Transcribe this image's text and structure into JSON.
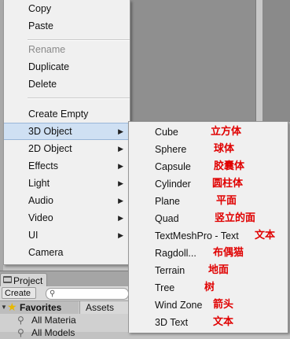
{
  "main_menu": {
    "items": [
      {
        "label": "Copy",
        "disabled": false,
        "submenu": false
      },
      {
        "label": "Paste",
        "disabled": false,
        "submenu": false
      },
      {
        "label": "Rename",
        "disabled": true,
        "submenu": false
      },
      {
        "label": "Duplicate",
        "disabled": false,
        "submenu": false
      },
      {
        "label": "Delete",
        "disabled": false,
        "submenu": false
      },
      {
        "label": "Create Empty",
        "disabled": false,
        "submenu": false
      },
      {
        "label": "3D Object",
        "disabled": false,
        "submenu": true,
        "selected": true
      },
      {
        "label": "2D Object",
        "disabled": false,
        "submenu": true
      },
      {
        "label": "Effects",
        "disabled": false,
        "submenu": true
      },
      {
        "label": "Light",
        "disabled": false,
        "submenu": true
      },
      {
        "label": "Audio",
        "disabled": false,
        "submenu": true
      },
      {
        "label": "Video",
        "disabled": false,
        "submenu": true
      },
      {
        "label": "UI",
        "disabled": false,
        "submenu": true
      },
      {
        "label": "Camera",
        "disabled": false,
        "submenu": false
      }
    ],
    "arrow_glyph": "▶"
  },
  "submenu_3d": {
    "items": [
      {
        "label": "Cube",
        "annotation": "立方体"
      },
      {
        "label": "Sphere",
        "annotation": "球体"
      },
      {
        "label": "Capsule",
        "annotation": "胶囊体"
      },
      {
        "label": "Cylinder",
        "annotation": "圆柱体"
      },
      {
        "label": "Plane",
        "annotation": "平面"
      },
      {
        "label": "Quad",
        "annotation": "竖立的面"
      },
      {
        "label": "TextMeshPro - Text",
        "annotation": "文本"
      },
      {
        "label": "Ragdoll...",
        "annotation": "布偶猫"
      },
      {
        "label": "Terrain",
        "annotation": "地面"
      },
      {
        "label": "Tree",
        "annotation": "树"
      },
      {
        "label": "Wind Zone",
        "annotation": "箭头"
      },
      {
        "label": "3D Text",
        "annotation": "文本"
      }
    ],
    "annotation_color": "#e00000"
  },
  "project_panel": {
    "tab_label": "Project",
    "create_label": "Create ▾",
    "favorites_label": "Favorites",
    "assets_label": "Assets",
    "favorites_items": [
      "All Materia",
      "All Models"
    ]
  },
  "colors": {
    "menu_bg": "#f0f0f0",
    "selected_bg": "#cfe0f3",
    "disabled_text": "#8a8a8a"
  }
}
